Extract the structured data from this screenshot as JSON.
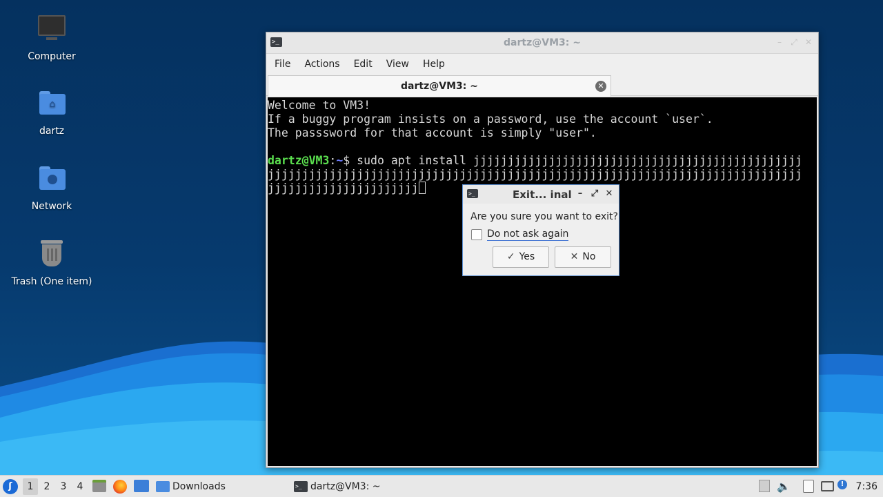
{
  "desktop": {
    "icons": [
      {
        "label": "Computer",
        "icon": "computer-icon"
      },
      {
        "label": "dartz",
        "icon": "home-folder-icon"
      },
      {
        "label": "Network",
        "icon": "network-folder-icon"
      },
      {
        "label": "Trash (One item)",
        "icon": "trash-icon"
      }
    ]
  },
  "terminal": {
    "window_title": "dartz@VM3: ~",
    "menu": [
      "File",
      "Actions",
      "Edit",
      "View",
      "Help"
    ],
    "tab_label": "dartz@VM3: ~",
    "lines": [
      "Welcome to VM3!",
      "If a buggy program insists on a password, use the account `user`.",
      "The passsword for that account is simply \"user\"."
    ],
    "prompt_user": "dartz@VM3",
    "prompt_sep": ":",
    "prompt_path": "~",
    "prompt_symbol": "$ ",
    "command_line_1": "sudo apt install jjjjjjjjjjjjjjjjjjjjjjjjjjjjjjjjjjjjjjjjjjjjjjjj",
    "command_line_2": "jjjjjjjjjjjjjjjjjjjjjjjjjjjjjjjjjjjjjjjjjjjjjjjjjjjjjjjjjjjjjjjjjjjjjjjjjjjjjj",
    "command_line_3": "jjjjjjjjjjjjjjjjjjjjjj"
  },
  "dialog": {
    "title": "Exit... inal",
    "question": "Are you sure you want to exit?",
    "checkbox_label": "Do not ask again",
    "checkbox_checked": false,
    "yes_label": "Yes",
    "no_label": "No"
  },
  "taskbar": {
    "workspaces": [
      "1",
      "2",
      "3",
      "4"
    ],
    "active_workspace": "1",
    "downloads_label": "Downloads",
    "terminal_task_label": "dartz@VM3: ~",
    "clock": "7:36"
  },
  "colors": {
    "desktop_bg": "#063a6e",
    "prompt_user": "#5be04f",
    "prompt_path": "#6d7cff",
    "dialog_border": "#5b8fd2"
  }
}
